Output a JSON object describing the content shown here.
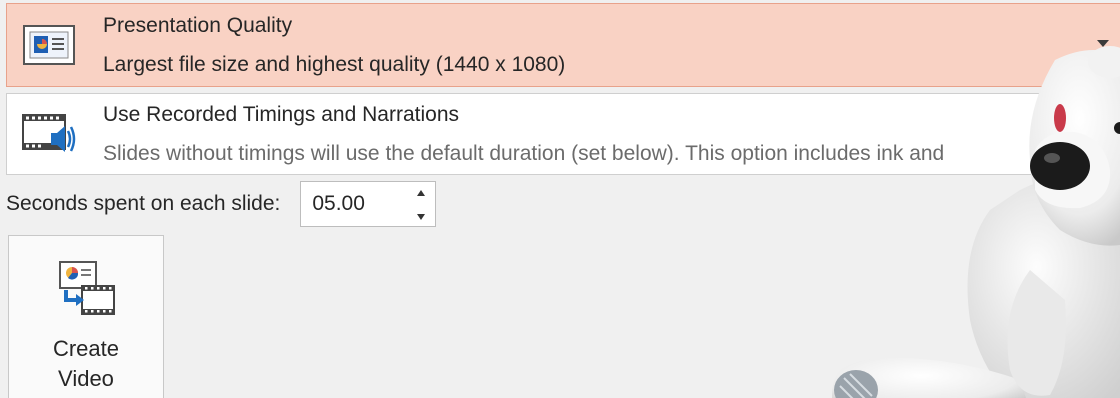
{
  "quality_dropdown": {
    "title": "Presentation Quality",
    "subtitle": "Largest file size and highest quality (1440 x 1080)",
    "icon": "presentation-quality-icon",
    "highlight_color": "#f9d2c4"
  },
  "timings_dropdown": {
    "title": "Use Recorded Timings and Narrations",
    "subtitle": "Slides without timings will use the default duration (set below). This option includes ink and",
    "icon": "film-speaker-icon"
  },
  "seconds": {
    "label": "Seconds spent on each slide:",
    "value": "05.00"
  },
  "create_video": {
    "line1": "Create",
    "line2": "Video",
    "icon": "create-video-icon"
  },
  "overlay": {
    "icon": "polar-bear-plush-image"
  }
}
